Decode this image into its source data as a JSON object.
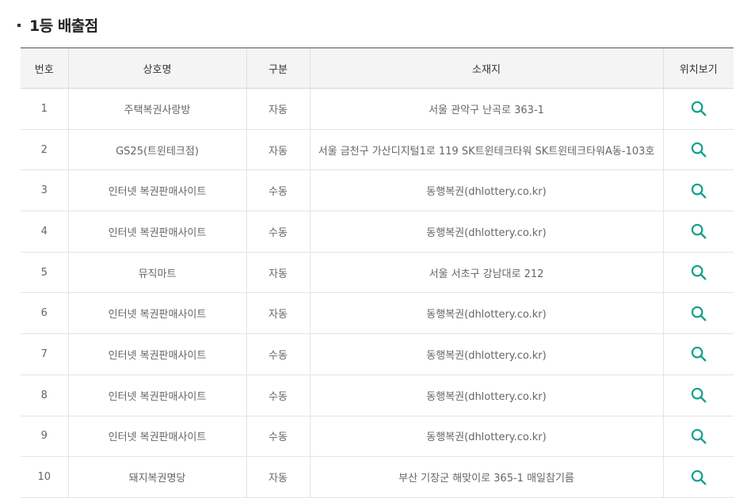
{
  "section": {
    "title": "1등 배출점"
  },
  "columns": [
    "번호",
    "상호명",
    "구분",
    "소재지",
    "위치보기"
  ],
  "accent_color": "#13a08c",
  "action_icon": "search-icon",
  "rows": [
    {
      "no": "1",
      "name": "주택복권사랑방",
      "type": "자동",
      "address": "서울 관악구 난곡로 363-1"
    },
    {
      "no": "2",
      "name": "GS25(트윈테크점)",
      "type": "자동",
      "address": "서울 금천구 가산디지털1로 119 SK트윈테크타워 SK트윈테크타워A동-103호"
    },
    {
      "no": "3",
      "name": "인터넷 복권판매사이트",
      "type": "수동",
      "address": "동행복권(dhlottery.co.kr)"
    },
    {
      "no": "4",
      "name": "인터넷 복권판매사이트",
      "type": "수동",
      "address": "동행복권(dhlottery.co.kr)"
    },
    {
      "no": "5",
      "name": "뮤직마트",
      "type": "자동",
      "address": "서울 서초구 강남대로 212"
    },
    {
      "no": "6",
      "name": "인터넷 복권판매사이트",
      "type": "자동",
      "address": "동행복권(dhlottery.co.kr)"
    },
    {
      "no": "7",
      "name": "인터넷 복권판매사이트",
      "type": "수동",
      "address": "동행복권(dhlottery.co.kr)"
    },
    {
      "no": "8",
      "name": "인터넷 복권판매사이트",
      "type": "수동",
      "address": "동행복권(dhlottery.co.kr)"
    },
    {
      "no": "9",
      "name": "인터넷 복권판매사이트",
      "type": "수동",
      "address": "동행복권(dhlottery.co.kr)"
    },
    {
      "no": "10",
      "name": "돼지복권명당",
      "type": "자동",
      "address": "부산 기장군 해맞이로 365-1 매일참기름"
    }
  ]
}
